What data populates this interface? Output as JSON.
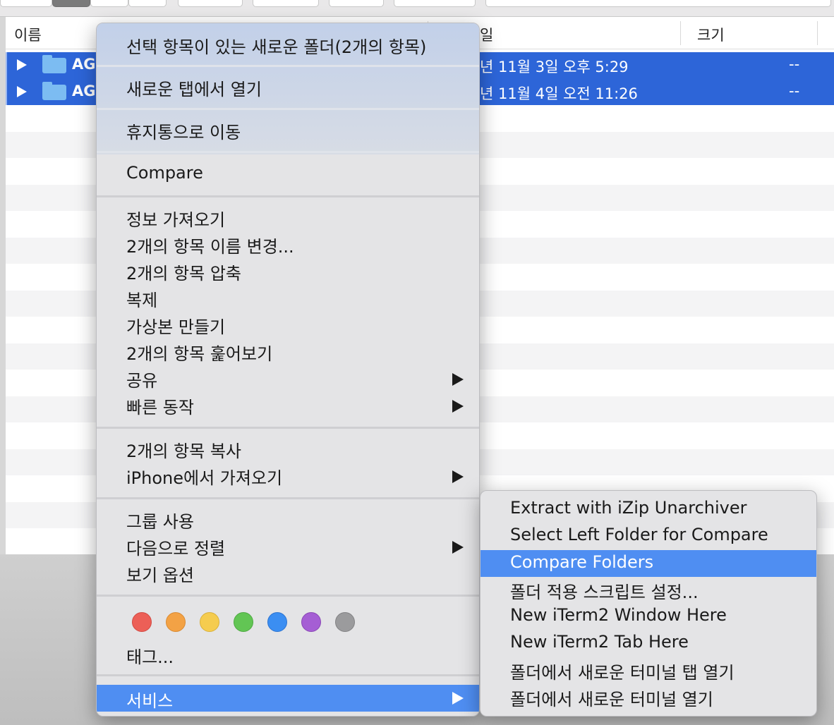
{
  "window": {
    "columns": {
      "name": "이름",
      "date_fragment": "일",
      "size": "크기"
    },
    "rows": [
      {
        "name": "AG",
        "date": "년 11월 3일 오후 5:29",
        "size": "--"
      },
      {
        "name": "AG",
        "date": "년 11월 4일 오전 11:26",
        "size": "--"
      }
    ]
  },
  "context_menu": {
    "groups": [
      [
        "선택 항목이 있는 새로운 폴더(2개의 항목)"
      ],
      [
        "새로운 탭에서 열기"
      ],
      [
        "휴지통으로 이동"
      ],
      [
        "Compare"
      ],
      [
        "정보 가져오기",
        "2개의 항목 이름 변경...",
        "2개의 항목 압축",
        "복제",
        "가상본 만들기",
        "2개의 항목 훑어보기",
        "공유",
        "빠른 동작"
      ],
      [
        "2개의 항목 복사",
        "iPhone에서 가져오기"
      ],
      [
        "그룹 사용",
        "다음으로 정렬",
        "보기 옵션"
      ]
    ],
    "submenu_items": [
      "공유",
      "빠른 동작",
      "iPhone에서 가져오기",
      "다음으로 정렬",
      "서비스"
    ],
    "tags_label": "태그...",
    "tag_colors": [
      "#ec5f57",
      "#f3a245",
      "#f5cc4f",
      "#62c554",
      "#3b8ef2",
      "#a55ed4",
      "#9b9b9d"
    ],
    "services": {
      "label": "서비스",
      "highlighted": true
    }
  },
  "services_submenu": {
    "items": [
      "Extract with iZip Unarchiver",
      "Select Left Folder for Compare",
      "Compare Folders",
      "폴더 적용 스크립트 설정...",
      "New iTerm2 Window Here",
      "New iTerm2 Tab Here",
      "폴더에서 새로운 터미널 탭 열기",
      "폴더에서 새로운 터미널 열기"
    ],
    "highlighted_item": "Compare Folders"
  }
}
